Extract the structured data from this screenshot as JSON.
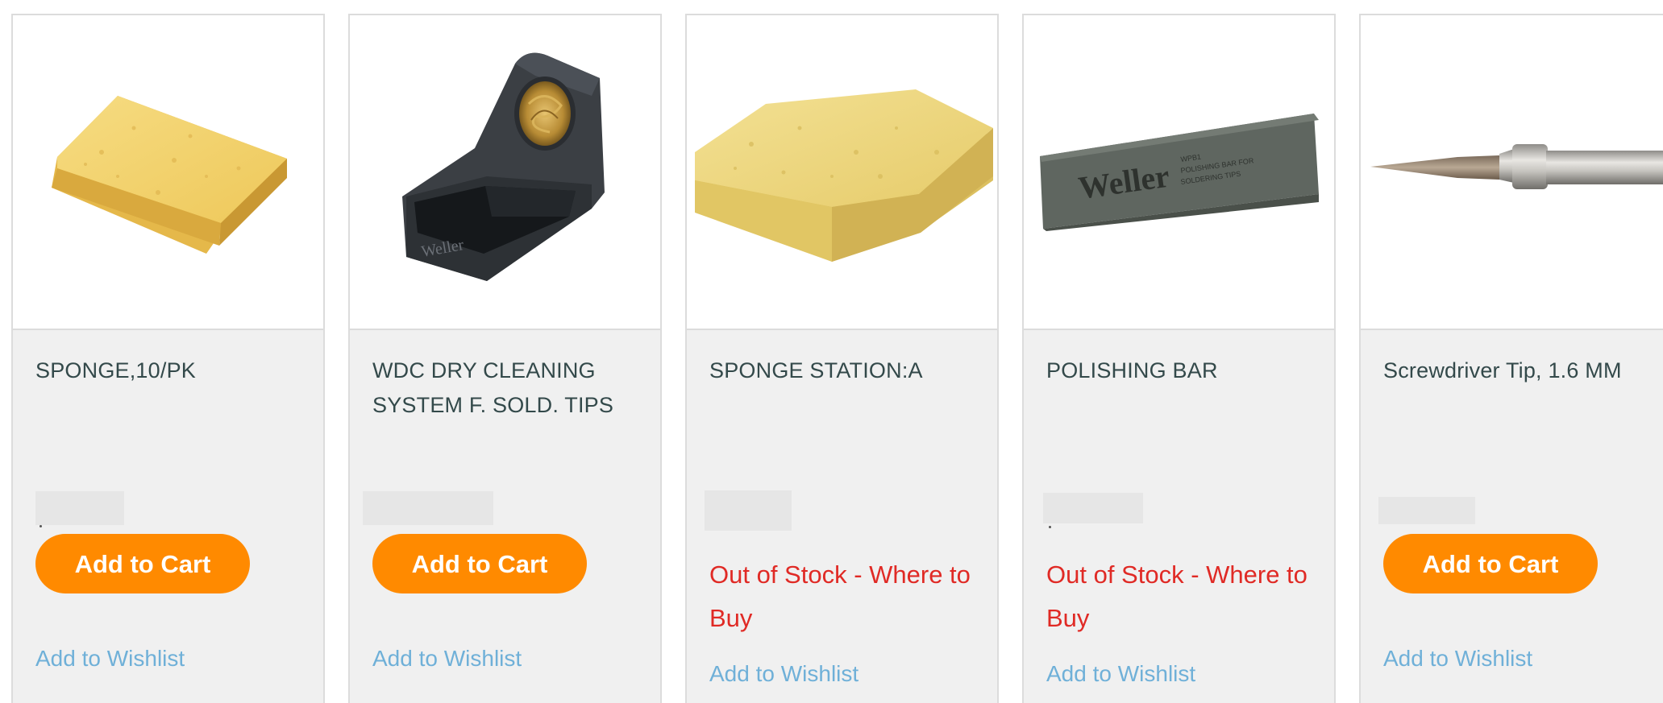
{
  "products": [
    {
      "title": "SPONGE,10/PK",
      "image": "yellow-sponge-image",
      "status": "in_stock",
      "cart_label": "Add to Cart",
      "wishlist_label": "Add to Wishlist"
    },
    {
      "title": "WDC DRY CLEANING SYSTEM F. SOLD. TIPS",
      "image": "dry-cleaning-station-image",
      "status": "in_stock",
      "cart_label": "Add to Cart",
      "wishlist_label": "Add to Wishlist"
    },
    {
      "title": "SPONGE STATION:A",
      "image": "thick-sponge-image",
      "status": "out_of_stock",
      "stock_label": "Out of Stock - Where to Buy",
      "wishlist_label": "Add to Wishlist"
    },
    {
      "title": "POLISHING BAR",
      "image": "weller-polishing-bar-image",
      "status": "out_of_stock",
      "stock_label": "Out of Stock - Where to Buy",
      "wishlist_label": "Add to Wishlist",
      "image_text": {
        "brand": "Weller",
        "line1": "WPB1",
        "line2": "POLISHING BAR FOR",
        "line3": "SOLDERING TIPS"
      }
    },
    {
      "title": "Screwdriver Tip, 1.6 MM",
      "image": "screwdriver-tip-image",
      "status": "in_stock",
      "cart_label": "Add to Cart",
      "wishlist_label": "Add to Wishlist"
    }
  ],
  "colors": {
    "accent_button": "#ff8a00",
    "out_of_stock": "#e02a25",
    "link": "#6fb0d8",
    "title_text": "#33494a",
    "card_bg": "#f0f0f0"
  }
}
